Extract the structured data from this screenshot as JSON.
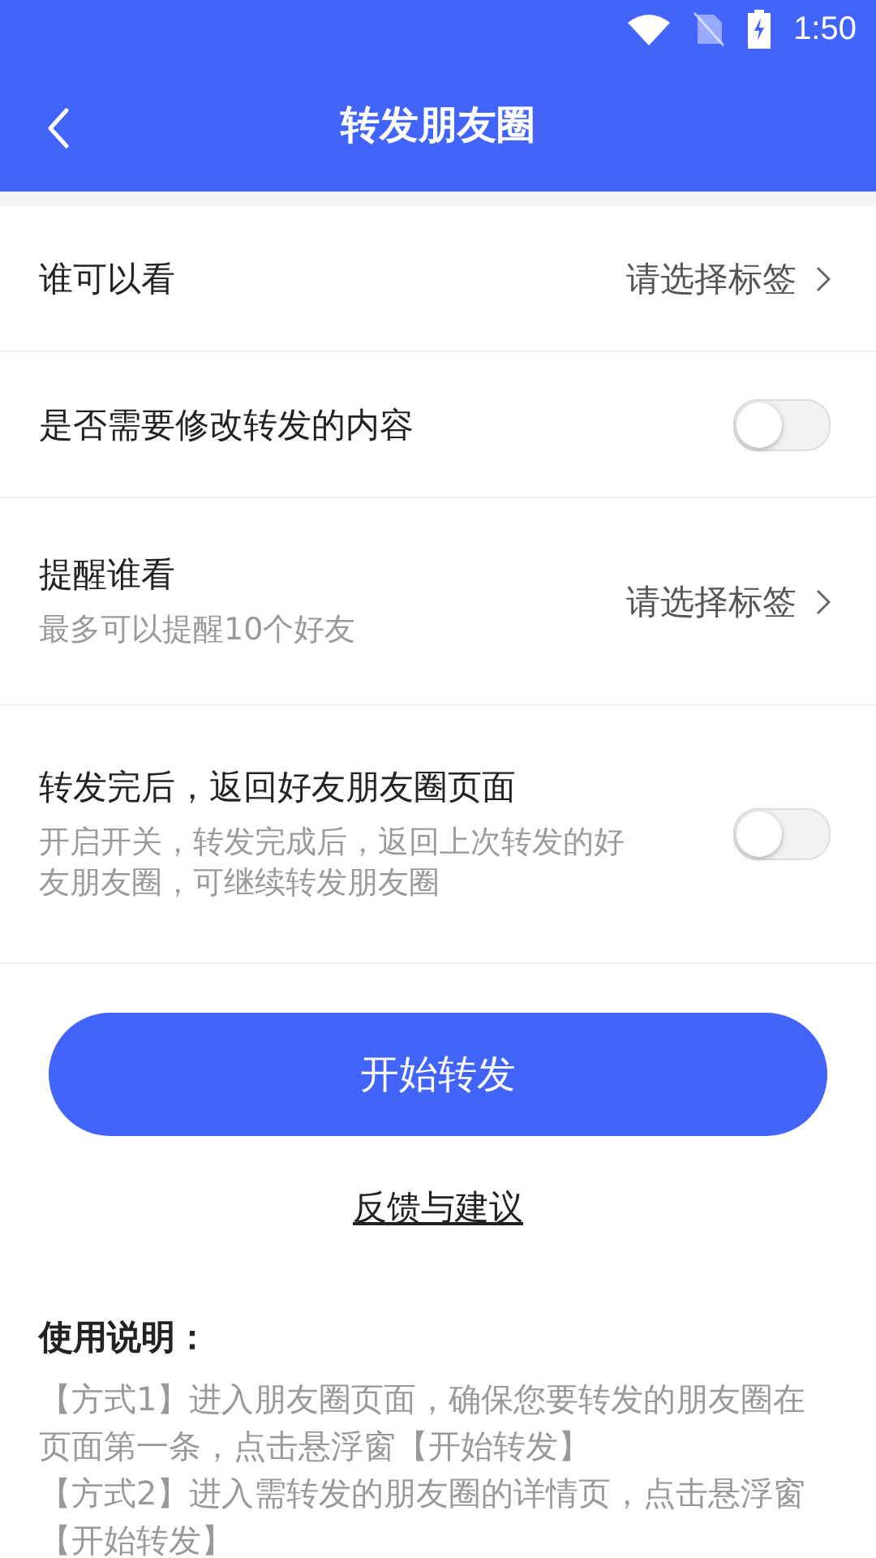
{
  "status_bar": {
    "time": "1:50"
  },
  "header": {
    "title": "转发朋友圈"
  },
  "settings": [
    {
      "kind": "select",
      "title": "谁可以看",
      "value": "请选择标签"
    },
    {
      "kind": "toggle",
      "title": "是否需要修改转发的内容",
      "on": false
    },
    {
      "kind": "select",
      "title": "提醒谁看",
      "subtitle": "最多可以提醒10个好友",
      "value": "请选择标签"
    },
    {
      "kind": "toggle",
      "title": "转发完后，返回好友朋友圈页面",
      "subtitle": "开启开关，转发完成后，返回上次转发的好友朋友圈，可继续转发朋友圈",
      "on": false
    }
  ],
  "start_button": "开始转发",
  "feedback_link": "反馈与建议",
  "instructions": {
    "title": "使用说明：",
    "paragraphs": [
      "【方式1】进入朋友圈页面，确保您要转发的朋友圈在页面第一条，点击悬浮窗【开始转发】",
      "【方式2】进入需转发的朋友圈的详情页，点击悬浮窗【开始转发】"
    ]
  }
}
